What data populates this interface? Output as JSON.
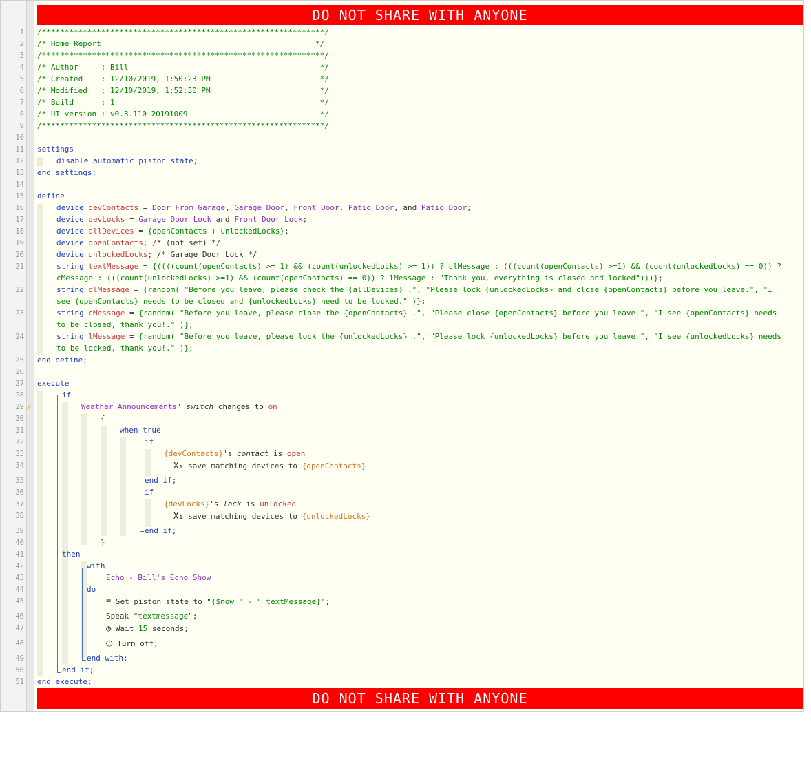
{
  "banner_text": "DO NOT SHARE WITH ANYONE",
  "icons": {
    "bolt": "lightning-bolt-icon",
    "counter": "counter-x1-icon",
    "state": "text-lines-icon",
    "wait": "clock-icon",
    "power": "power-icon"
  },
  "lines": [
    {
      "n": "1",
      "t": "/**************************************************************/"
    },
    {
      "n": "2",
      "t": "/* Home Report                                               */"
    },
    {
      "n": "3",
      "t": "/**************************************************************/"
    },
    {
      "n": "4",
      "t": "/* Author     : Bill                                          */"
    },
    {
      "n": "5",
      "t": "/* Created    : 12/10/2019, 1:50:23 PM                        */"
    },
    {
      "n": "6",
      "t": "/* Modified   : 12/10/2019, 1:52:30 PM                        */"
    },
    {
      "n": "7",
      "t": "/* Build      : 1                                             */"
    },
    {
      "n": "8",
      "t": "/* UI version : v0.3.110.20191009                             */"
    },
    {
      "n": "9",
      "t": "/**************************************************************/"
    }
  ],
  "code": {
    "l11": "settings",
    "l12": "disable automatic piston state;",
    "l13": "end settings;",
    "l15": "define",
    "l16": [
      "device ",
      "devContacts",
      " = ",
      "Door From Garage",
      ", ",
      "Garage Door",
      ", ",
      "Front Door",
      ", ",
      "Patio Door",
      ", and ",
      "Patio Door",
      ";"
    ],
    "l17": [
      "device ",
      "devLocks",
      " = ",
      "Garage Door Lock",
      " and ",
      "Front Door Lock",
      ";"
    ],
    "l18": [
      "device ",
      "allDevices",
      " = ",
      "{openContacts + unlockedLocks}",
      ";"
    ],
    "l19": [
      "device ",
      "openContacts",
      "; ",
      "/* (not set) */"
    ],
    "l20": [
      "device ",
      "unlockedLocks",
      "; ",
      "/* Garage Door Lock */"
    ],
    "l21a": [
      "string ",
      "textMessage",
      " = ",
      "{((((count(openContacts) >= 1) && (count(unlockedLocks) >= 1)) ? clMessage : (((count(openContacts) >=1) && (count(unlockedLocks) == 0)) ?"
    ],
    "l21b": "cMessage : (((count(unlockedLocks) >=1) && (count(openContacts) == 0)) ? lMessage : \"Thank you, everything is closed and locked\")))}",
    "l21c": ";",
    "l22a": [
      "string ",
      "clMessage",
      " = ",
      "{random( \"Before you leave, please check the {allDevices} .\", \"Please lock {unlockedLocks} and close {openContacts} before you leave.\", \"I"
    ],
    "l22b": "see {openContacts} needs to be closed and {unlockedLocks} need to be locked.\" )}",
    "l23a": [
      "string ",
      "cMessage",
      " = ",
      "{random( \"Before you leave, please close the {openContacts} .\", \"Please close {openContacts} before you leave.\", \"I see {openContacts} needs"
    ],
    "l23b": "to be closed, thank you!.\" )}",
    "l24a": [
      "string ",
      "lMessage",
      " = ",
      "{random( \"Before you leave, please lock the {unlockedLocks} .\", \"Please lock {unlockedLocks} before you leave.\", \"I see {unlockedLocks} needs"
    ],
    "l24b": "to be locked, thank you!.\" )}",
    "l25": "end define;",
    "l27": "execute",
    "l28": "if",
    "l29": [
      "Weather Announcements",
      "' ",
      "switch",
      " changes to ",
      "on"
    ],
    "l30": "{",
    "l31": "when true",
    "l32": "if",
    "l33": [
      "{devContacts}",
      "'s ",
      "contact",
      " is ",
      "open"
    ],
    "l34": [
      "save matching devices to ",
      "{openContacts}"
    ],
    "l35": "end if;",
    "l36": "if",
    "l37": [
      "{devLocks}",
      "'s ",
      "lock",
      " is ",
      "unlocked"
    ],
    "l38": [
      "save matching devices to ",
      "{unlockedLocks}"
    ],
    "l39": "end if;",
    "l40": "}",
    "l41": "then",
    "l42": "with",
    "l43": "Echo - Bill's Echo Show",
    "l44": "do",
    "l45": [
      "Set piston state to \"",
      "{$now \" - \" textMessage}",
      "\";"
    ],
    "l46": [
      "Speak \"",
      "textmessage",
      "\";"
    ],
    "l47": [
      "Wait ",
      "15",
      " seconds;"
    ],
    "l48": "Turn off;",
    "l49": "end with;",
    "l50": "end if;",
    "l51": "end execute;"
  },
  "line_numbers": [
    "1",
    "2",
    "3",
    "4",
    "5",
    "6",
    "7",
    "8",
    "9",
    "10",
    "11",
    "12",
    "13",
    "14",
    "15",
    "16",
    "17",
    "18",
    "19",
    "20",
    "21",
    "22",
    "23",
    "24",
    "25",
    "26",
    "27",
    "28",
    "29",
    "30",
    "31",
    "32",
    "33",
    "34",
    "35",
    "36",
    "37",
    "38",
    "39",
    "40",
    "41",
    "42",
    "43",
    "44",
    "45",
    "46",
    "47",
    "48",
    "49",
    "50",
    "51"
  ]
}
